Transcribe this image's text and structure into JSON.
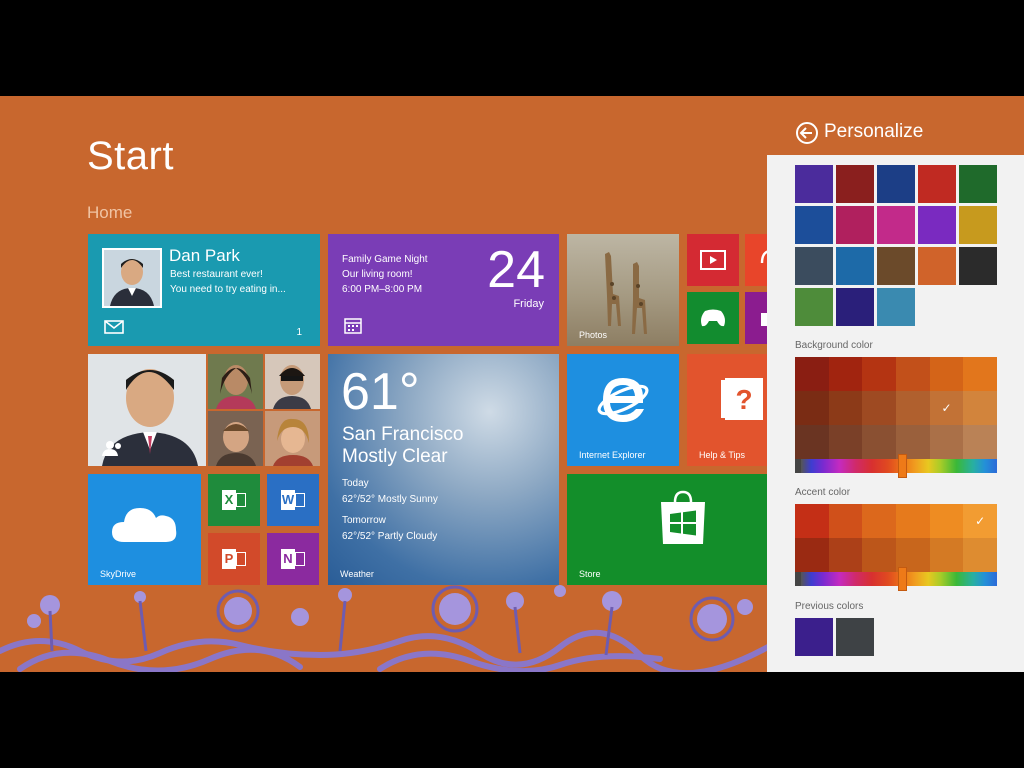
{
  "start": {
    "title": "Start",
    "group": "Home"
  },
  "tiles": {
    "mail": {
      "name": "Dan Park",
      "line1": "Best restaurant ever!",
      "line2": "You need to try eating in...",
      "count": "1",
      "icon": "mail-icon"
    },
    "calendar": {
      "line1": "Family Game Night",
      "line2": "Our living room!",
      "line3": "6:00 PM–8:00 PM",
      "day": "24",
      "weekday": "Friday",
      "icon": "calendar-icon"
    },
    "photos": {
      "label": "Photos"
    },
    "weather": {
      "temp": "61°",
      "city": "San Francisco",
      "condition": "Mostly Clear",
      "today_label": "Today",
      "today_forecast": "62°/52° Mostly Sunny",
      "tomorrow_label": "Tomorrow",
      "tomorrow_forecast": "62°/52° Partly Cloudy",
      "label": "Weather"
    },
    "ie": {
      "label": "Internet Explorer"
    },
    "help": {
      "label": "Help & Tips"
    },
    "skydrive": {
      "label": "SkyDrive"
    },
    "store": {
      "label": "Store"
    },
    "excel": {
      "glyph": "X"
    },
    "word": {
      "glyph": "W"
    },
    "powerpoint": {
      "glyph": "P"
    },
    "onenote": {
      "glyph": "N"
    }
  },
  "pane": {
    "title": "Personalize",
    "background_label": "Background color",
    "accent_label": "Accent color",
    "previous_label": "Previous colors",
    "background_hue_percent": 53,
    "accent_hue_percent": 53,
    "previous_colors": [
      "#3b1f8c",
      "#3e4245"
    ],
    "checkmark": "✓"
  },
  "colors": {
    "screen_bg": "#c8672e",
    "pane_bg": "#f2f2f2"
  }
}
